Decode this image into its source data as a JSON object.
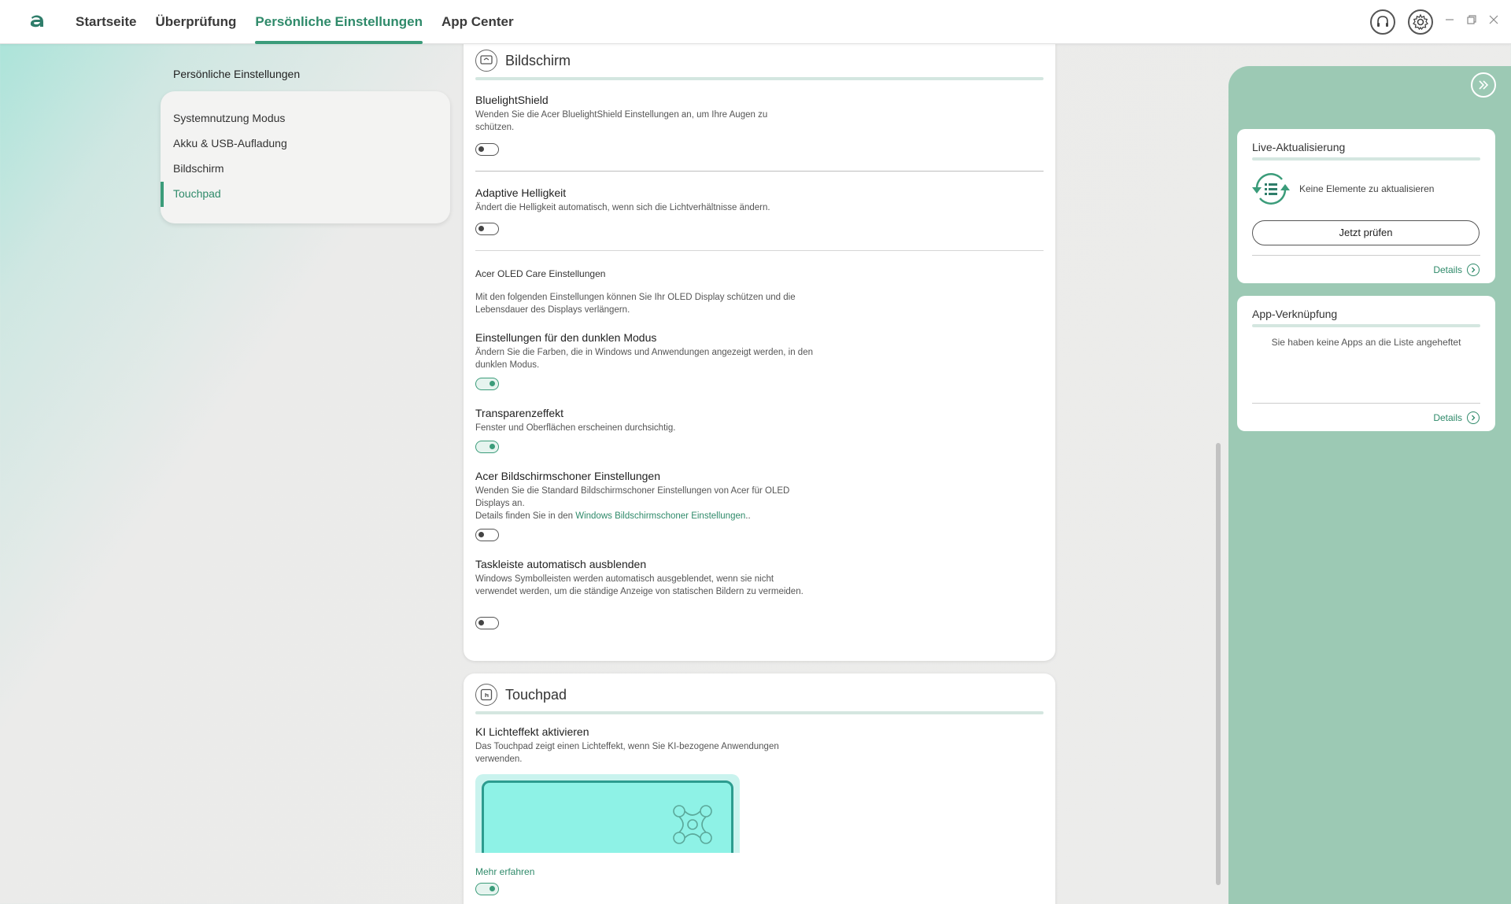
{
  "nav": {
    "tabs": [
      "Startseite",
      "Überprüfung",
      "Persönliche Einstellungen",
      "App Center"
    ],
    "active": "Persönliche Einstellungen"
  },
  "header_icons": [
    "headset-icon",
    "gear-icon",
    "minimize-icon",
    "restore-icon",
    "close-icon"
  ],
  "sidebar": {
    "title": "Persönliche Einstellungen",
    "items": [
      "Systemnutzung Modus",
      "Akku & USB-Aufladung",
      "Bildschirm",
      "Touchpad"
    ],
    "active": "Touchpad"
  },
  "bildschirm": {
    "title": "Bildschirm",
    "bluelight": {
      "title": "BluelightShield",
      "desc": "Wenden Sie die Acer BluelightShield Einstellungen an, um Ihre Augen zu schützen.",
      "enabled": false
    },
    "adaptive": {
      "title": "Adaptive Helligkeit",
      "desc": "Ändert die Helligkeit automatisch, wenn sich die Lichtverhältnisse ändern.",
      "enabled": false
    },
    "oled_heading": "Acer OLED Care Einstellungen",
    "oled_desc": "Mit den folgenden Einstellungen können Sie Ihr OLED Display schützen und die Lebensdauer des Displays verlängern.",
    "dark_mode": {
      "title": "Einstellungen für den dunklen Modus",
      "desc": "Ändern Sie die Farben, die in Windows und Anwendungen angezeigt werden, in den dunklen Modus.",
      "enabled": true
    },
    "transparency": {
      "title": "Transparenzeffekt",
      "desc": "Fenster und Oberflächen erscheinen durchsichtig.",
      "enabled": true
    },
    "screensaver": {
      "title": "Acer Bildschirmschoner Einstellungen",
      "desc": "Wenden Sie die Standard Bildschirmschoner Einstellungen von Acer für OLED Displays an.",
      "desc2_prefix": "Details finden Sie in den ",
      "desc2_link": "Windows Bildschirmschoner Einstellungen",
      "desc2_suffix": "..",
      "enabled": false
    },
    "taskbar": {
      "title": "Taskleiste automatisch ausblenden",
      "desc": "Windows Symbolleisten werden automatisch ausgeblendet, wenn sie nicht verwendet werden, um die ständige Anzeige von statischen Bildern zu vermeiden.",
      "enabled": false
    }
  },
  "touchpad": {
    "title": "Touchpad",
    "ki": {
      "title": "KI Lichteffekt aktivieren",
      "desc": "Das Touchpad zeigt einen Lichteffekt, wenn Sie KI-bezogene Anwendungen verwenden.",
      "enabled": true
    },
    "learn_more": "Mehr erfahren"
  },
  "right_panel": {
    "live_update": {
      "title": "Live-Aktualisierung",
      "status": "Keine Elemente zu aktualisieren",
      "button": "Jetzt prüfen",
      "details": "Details"
    },
    "app_shortcut": {
      "title": "App-Verknüpfung",
      "empty": "Sie haben keine Apps an die Liste angeheftet",
      "details": "Details"
    }
  },
  "colors": {
    "accent": "#3b9c7a",
    "accent_text": "#2f8a6a",
    "right_panel_bg": "#9cc9b4"
  }
}
